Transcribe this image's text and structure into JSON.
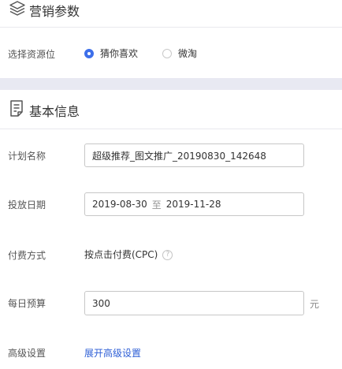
{
  "section1": {
    "title": "营销参数",
    "icon": "layers-icon",
    "resource_label": "选择资源位",
    "options": [
      {
        "label": "猜你喜欢",
        "checked": true
      },
      {
        "label": "微淘",
        "checked": false
      }
    ]
  },
  "section2": {
    "title": "基本信息",
    "icon": "document-icon",
    "plan_name_label": "计划名称",
    "plan_name_value": "超级推荐_图文推广_20190830_142648",
    "date_label": "投放日期",
    "date_start": "2019-08-30",
    "date_sep": "至",
    "date_end": "2019-11-28",
    "billing_label": "付费方式",
    "billing_value": "按点击付费(CPC)",
    "budget_label": "每日预算",
    "budget_value": "300",
    "budget_unit": "元",
    "advanced_label": "高级设置",
    "advanced_link": "展开高级设置"
  },
  "colors": {
    "accent": "#3d6fea",
    "link": "#2e5fd6",
    "band": "#e8e9f2"
  }
}
